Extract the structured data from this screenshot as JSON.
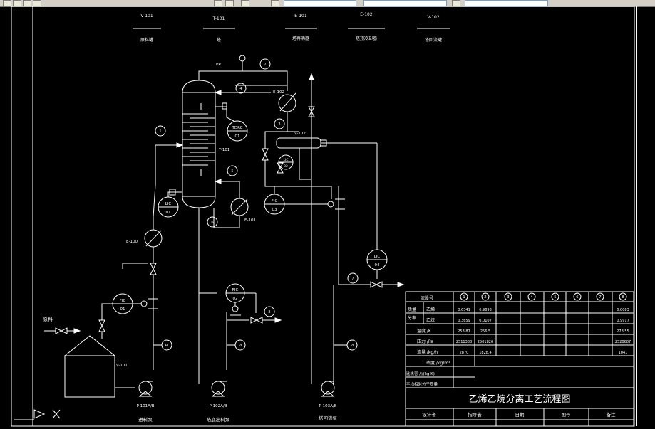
{
  "equipment_list": [
    {
      "tag": "V-101",
      "name": "原料罐"
    },
    {
      "tag": "T-101",
      "name": "塔"
    },
    {
      "tag": "E-101",
      "name": "塔再沸器"
    },
    {
      "tag": "E-102",
      "name": "塔顶冷却器"
    },
    {
      "tag": "V-102",
      "name": "塔回流罐"
    }
  ],
  "labels": {
    "pr": "PR",
    "t101": "T-101",
    "e102": "E-102",
    "v102": "V-102",
    "e101": "E-101",
    "e100": "E-100",
    "v101": "V-101",
    "feed": "原料",
    "tdrc_tag": "TDRC",
    "tdrc_num": "01",
    "lic01_tag": "LIC",
    "lic01_num": "01",
    "lic02_tag": "LIC",
    "lic02_num": "02",
    "lic04_tag": "LIC",
    "lic04_num": "04",
    "fic03_tag": "FIC",
    "fic03_num": "03",
    "fic01_tag": "FIC",
    "fic01_num": "01",
    "fic02_tag": "FIC",
    "fic02_num": "02",
    "pi": "PI",
    "stream1": "1",
    "stream2": "2",
    "stream3": "3",
    "stream4": "4",
    "stream5": "5",
    "stream6": "6",
    "stream7": "7",
    "stream8": "8"
  },
  "pumps": [
    {
      "tag": "P-101A/B",
      "name": "进料泵"
    },
    {
      "tag": "P-102A/B",
      "name": "塔底出料泵"
    },
    {
      "tag": "P-103A/B",
      "name": "塔回流泵"
    }
  ],
  "table": {
    "header_label": "流股号",
    "stream_numbers": [
      "1",
      "2",
      "3",
      "4",
      "5",
      "6",
      "7",
      "8"
    ],
    "group_label_1": "质量",
    "group_label_2": "分率",
    "rows": [
      {
        "label": "乙烯",
        "values": [
          "0.6341",
          "0.9893",
          "",
          "",
          "",
          "",
          "",
          "0.0083"
        ]
      },
      {
        "label": "乙烷",
        "values": [
          "0.3659",
          "0.0107",
          "",
          "",
          "",
          "",
          "",
          "0.9917"
        ]
      },
      {
        "label": "温度 /K",
        "values": [
          "253.87",
          "256.5",
          "",
          "",
          "",
          "",
          "",
          "278.55"
        ]
      },
      {
        "label": "压力 /Pa",
        "values": [
          "2511388",
          "2501826",
          "",
          "",
          "",
          "",
          "",
          "2520687"
        ]
      },
      {
        "label": "流量 /kg/h",
        "values": [
          "2870",
          "1828.4",
          "",
          "",
          "",
          "",
          "",
          "1041"
        ]
      },
      {
        "label": "密度 /kg/m³",
        "values": [
          "",
          "",
          "",
          "",
          "",
          "",
          "",
          ""
        ]
      },
      {
        "label": "比热容 /J/(kg·K)",
        "values": [
          "",
          "",
          "",
          "",
          "",
          "",
          "",
          ""
        ]
      },
      {
        "label": "平均相对分子质量",
        "values": [
          "",
          "",
          "",
          "",
          "",
          "",
          "",
          ""
        ]
      }
    ],
    "title": "乙烯乙烷分离工艺流程图",
    "footer": [
      "设计者",
      "指导者",
      "日期",
      "图号",
      "备注"
    ]
  },
  "colors": {
    "background": "#000000",
    "line": "#ffffff"
  }
}
